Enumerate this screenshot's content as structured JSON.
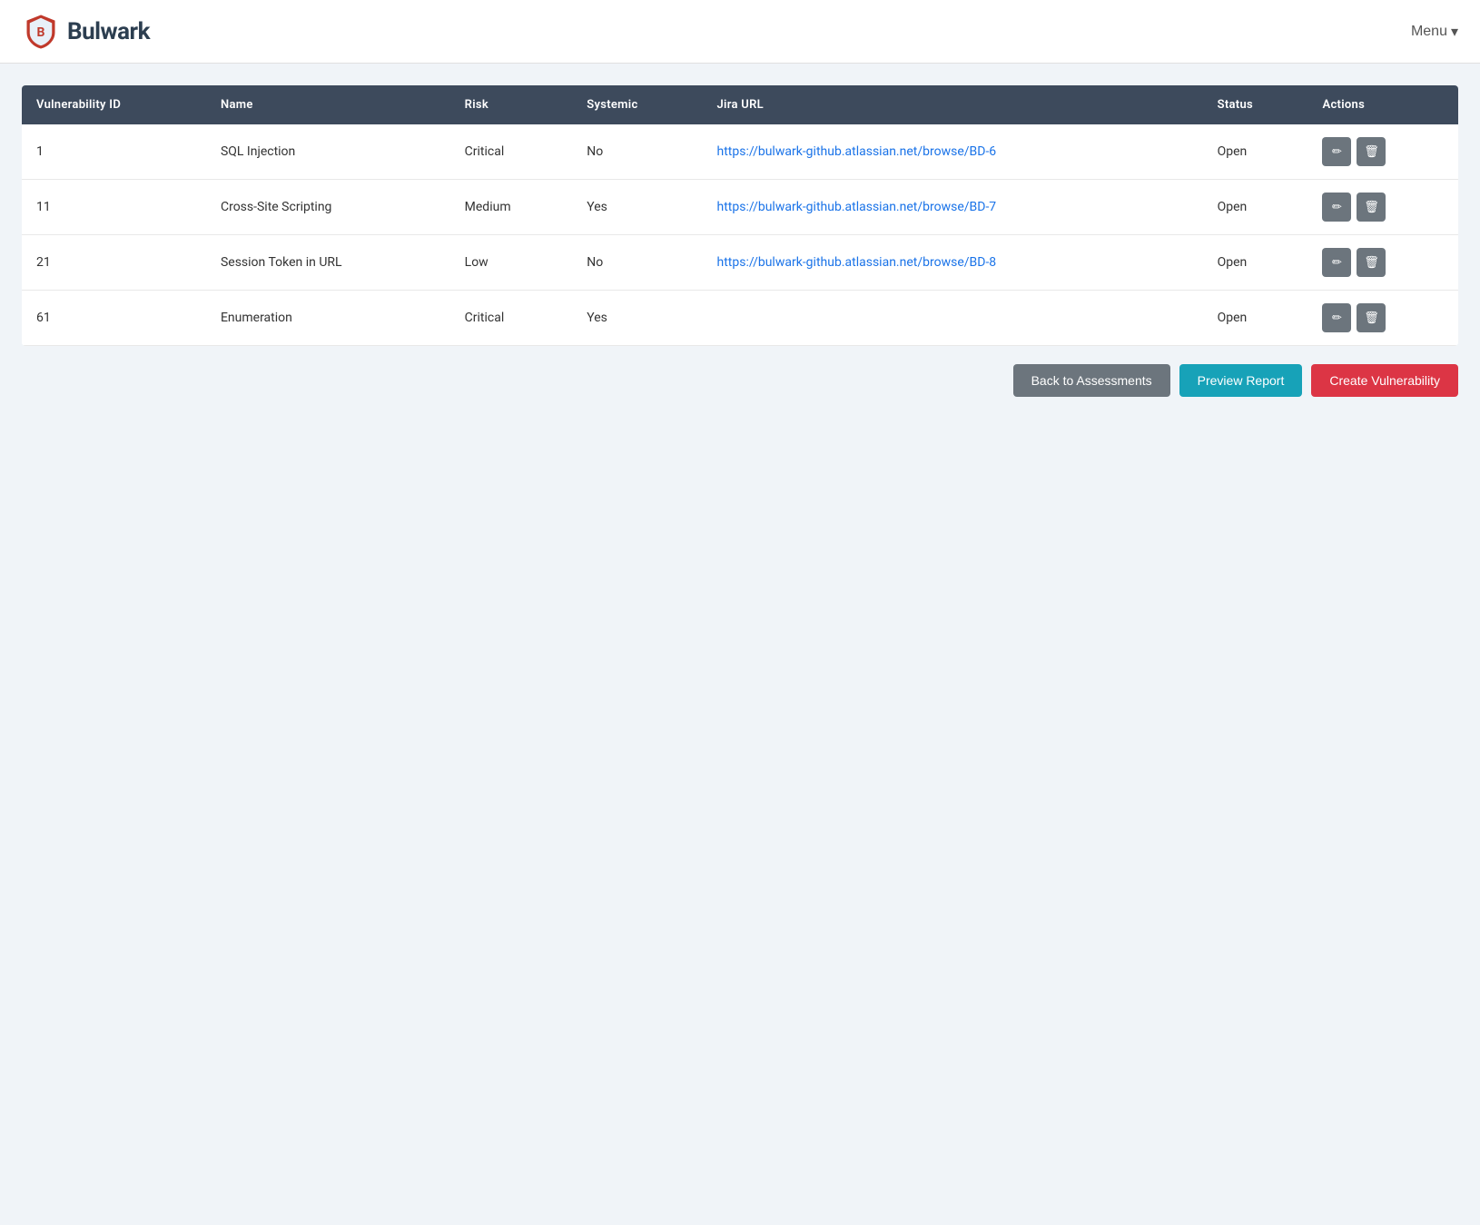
{
  "app": {
    "name": "Bulwark"
  },
  "navbar": {
    "menu_label": "Menu"
  },
  "table": {
    "columns": [
      {
        "key": "vuln_id",
        "label": "Vulnerability ID"
      },
      {
        "key": "name",
        "label": "Name"
      },
      {
        "key": "risk",
        "label": "Risk"
      },
      {
        "key": "systemic",
        "label": "Systemic"
      },
      {
        "key": "jira_url",
        "label": "Jira URL"
      },
      {
        "key": "status",
        "label": "Status"
      },
      {
        "key": "actions",
        "label": "Actions"
      }
    ],
    "rows": [
      {
        "id": "1",
        "name": "SQL Injection",
        "risk": "Critical",
        "systemic": "No",
        "jira_url": "https://bulwark-github.atlassian.net/browse/BD-6",
        "status": "Open"
      },
      {
        "id": "11",
        "name": "Cross-Site Scripting",
        "risk": "Medium",
        "systemic": "Yes",
        "jira_url": "https://bulwark-github.atlassian.net/browse/BD-7",
        "status": "Open"
      },
      {
        "id": "21",
        "name": "Session Token in URL",
        "risk": "Low",
        "systemic": "No",
        "jira_url": "https://bulwark-github.atlassian.net/browse/BD-8",
        "status": "Open"
      },
      {
        "id": "61",
        "name": "Enumeration",
        "risk": "Critical",
        "systemic": "Yes",
        "jira_url": "",
        "status": "Open"
      }
    ]
  },
  "actions": {
    "back_label": "Back to Assessments",
    "preview_label": "Preview Report",
    "create_label": "Create Vulnerability"
  },
  "icons": {
    "edit": "✏",
    "delete": "🗑",
    "chevron": "▾"
  }
}
